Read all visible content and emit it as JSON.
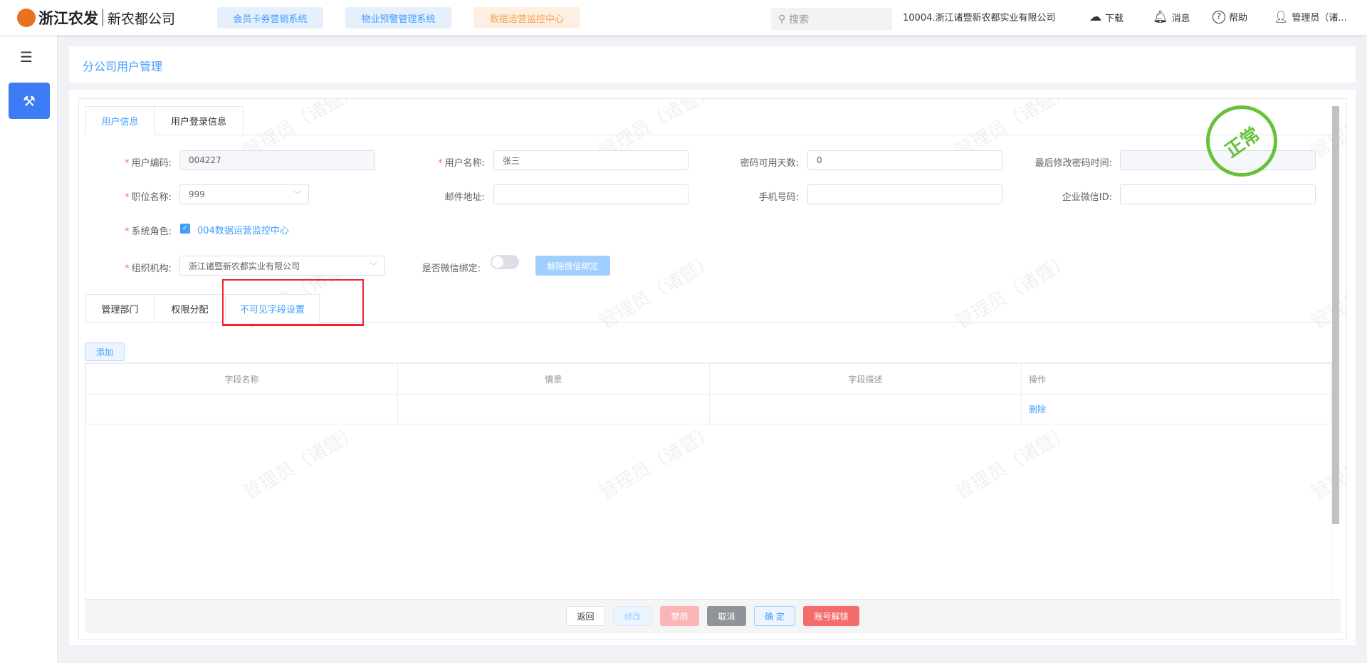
{
  "header": {
    "brand": "浙江农发",
    "company_short": "新农都公司",
    "systems": [
      {
        "label": "会员卡券营销系统",
        "color": "#409eff",
        "bg": "#e6f0fc"
      },
      {
        "label": "物业预警管理系统",
        "color": "#409eff",
        "bg": "#e6f0fc"
      },
      {
        "label": "数据运营监控中心",
        "color": "#f7a24a",
        "bg": "#fdf0e3"
      }
    ],
    "search_placeholder": "搜索",
    "org": "10004.浙江诸暨新农都实业有限公司",
    "download": "下载",
    "messages": "消息",
    "help": "帮助",
    "user": "管理员（诸..."
  },
  "page": {
    "title": "分公司用户管理"
  },
  "watermark": "管理员（诸暨）",
  "tabs": [
    "用户信息",
    "用户登录信息"
  ],
  "form": {
    "user_code_label": "用户编码:",
    "user_code": "004227",
    "user_name_label": "用户名称:",
    "user_name": "张三",
    "pwd_days_label": "密码可用天数:",
    "pwd_days": "0",
    "last_pwd_label": "最后修改密码时间:",
    "last_pwd": "",
    "position_label": "职位名称:",
    "position": "999",
    "email_label": "邮件地址:",
    "email": "",
    "phone_label": "手机号码:",
    "phone": "",
    "wechat_id_label": "企业微信ID:",
    "wechat_id": "",
    "role_label": "系统角色:",
    "role": "004数据运营监控中心",
    "org_label": "组织机构:",
    "org": "浙江诸暨新农都实业有限公司",
    "wechat_bind_label": "是否微信绑定:",
    "unbind_label": "解除微信绑定"
  },
  "stamp": "正常",
  "subtabs": [
    "管理部门",
    "权限分配",
    "不可见字段设置"
  ],
  "add_label": "添加",
  "table": {
    "columns": [
      "字段名称",
      "情景",
      "字段描述",
      "操作"
    ],
    "rows": [
      {
        "field": "",
        "scene": "",
        "desc": "",
        "action": "删除"
      }
    ]
  },
  "footer": {
    "back": "返回",
    "edit": "修改",
    "disable": "禁用",
    "cancel": "取消",
    "confirm": "确 定",
    "unlock": "账号解锁"
  }
}
